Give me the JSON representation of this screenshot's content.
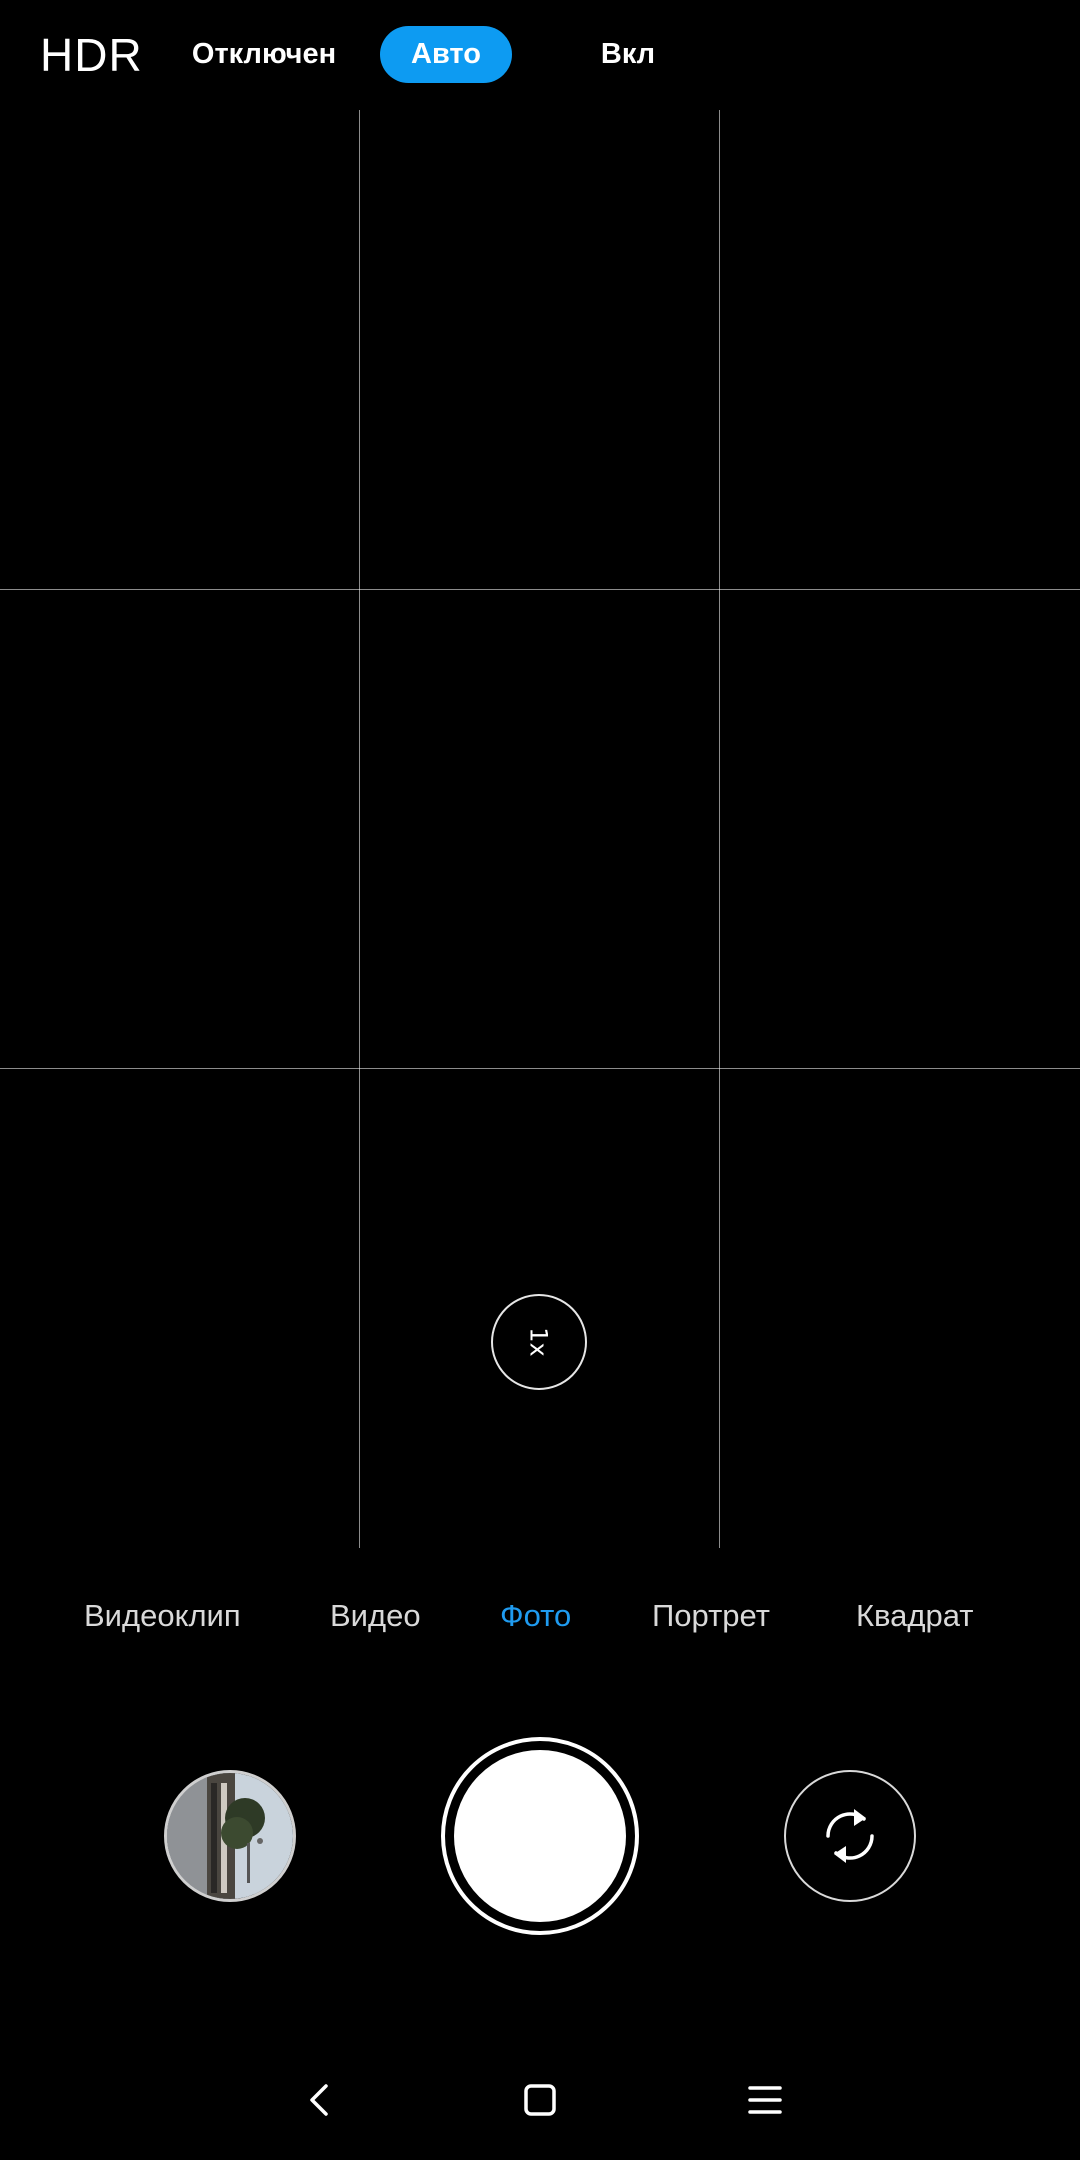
{
  "hdr": {
    "label": "HDR",
    "options": [
      {
        "label": "Отключен",
        "selected": false
      },
      {
        "label": "Авто",
        "selected": true
      },
      {
        "label": "Вкл",
        "selected": false
      }
    ],
    "accent_color": "#0d9bf2"
  },
  "zoom": {
    "label": "1x"
  },
  "modes": {
    "items": [
      {
        "label": "Видеоклип",
        "active": false
      },
      {
        "label": "Видео",
        "active": false
      },
      {
        "label": "Фото",
        "active": true
      },
      {
        "label": "Портрет",
        "active": false
      },
      {
        "label": "Квадрат",
        "active": false
      }
    ],
    "active_color": "#1f9bf0"
  },
  "controls": {
    "gallery_icon": "gallery-thumbnail",
    "shutter_icon": "shutter-button",
    "switch_icon": "camera-switch-icon"
  },
  "nav": {
    "back_icon": "back-icon",
    "home_icon": "home-icon",
    "menu_icon": "menu-icon"
  }
}
